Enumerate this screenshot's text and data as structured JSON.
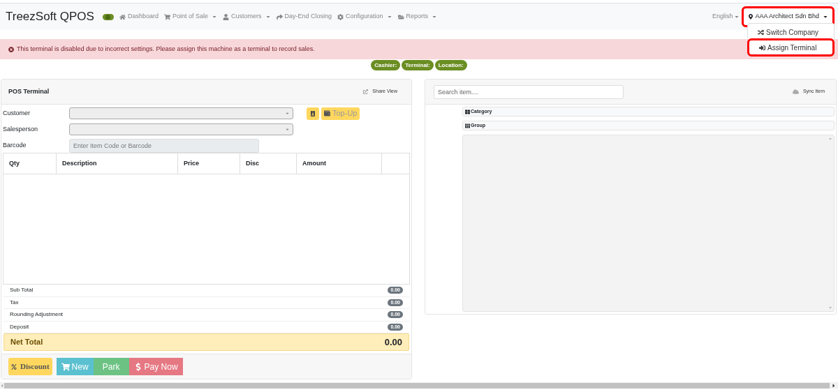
{
  "navbar": {
    "brand": "TreezSoft QPOS",
    "nav": [
      {
        "label": "Dashboard",
        "dropdown": false
      },
      {
        "label": "Point of Sale",
        "dropdown": true
      },
      {
        "label": "Customers",
        "dropdown": true
      },
      {
        "label": "Day-End Closing",
        "dropdown": false
      },
      {
        "label": "Configuration",
        "dropdown": true
      },
      {
        "label": "Reports",
        "dropdown": true
      }
    ],
    "language": "English",
    "company": {
      "label": "AAA Architect Sdn Bhd",
      "highlighted": true
    },
    "company_menu": [
      {
        "label": "Switch Company",
        "highlighted": false
      },
      {
        "label": "Assign Terminal",
        "highlighted": true
      }
    ]
  },
  "alert": "This terminal is disabled due to incorrect settings. Please assign this machine as a terminal to record sales.",
  "badges": [
    "Cashier:",
    "Terminal:",
    "Location:"
  ],
  "pos": {
    "title": "POS Terminal",
    "share": "Share View",
    "fields": [
      {
        "label": "Customer",
        "kind": "select"
      },
      {
        "label": "Salesperson",
        "kind": "select"
      },
      {
        "label": "Barcode",
        "kind": "input",
        "placeholder": "Enter Item Code or Barcode"
      }
    ],
    "topup": "Top-Up",
    "columns": [
      "Qty",
      "Description",
      "Price",
      "Disc",
      "Amount"
    ],
    "summary": [
      {
        "label": "Sub Total",
        "value": "0.00"
      },
      {
        "label": "Tax",
        "value": "0.00"
      },
      {
        "label": "Rounding Adjustment",
        "value": "0.00"
      },
      {
        "label": "Deposit",
        "value": "0.00"
      }
    ],
    "net_total": {
      "label": "Net Total",
      "value": "0.00"
    },
    "discount": "Discount",
    "actions": [
      {
        "label": "New",
        "color": "#5bc0cf"
      },
      {
        "label": "Park",
        "color": "#6cc283"
      },
      {
        "label": "Pay Now",
        "color": "#e57882"
      }
    ]
  },
  "items": {
    "search_placeholder": "Search item....",
    "sync": "Sync Item",
    "sections": [
      "Category",
      "Group"
    ]
  }
}
